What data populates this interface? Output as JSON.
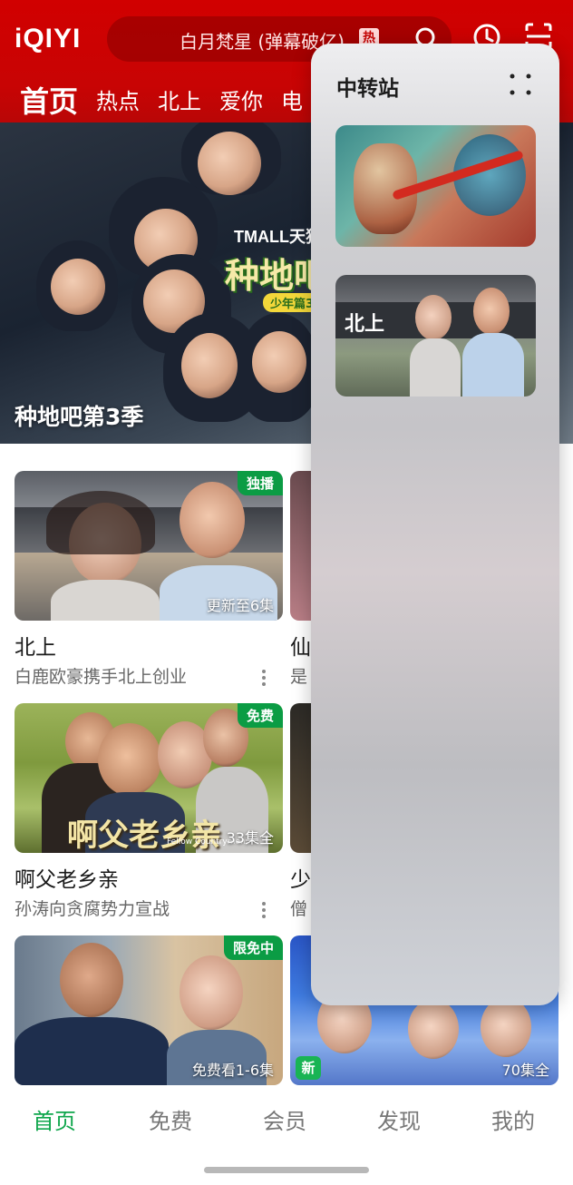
{
  "header": {
    "logo": "iQIYI",
    "search_text": "白月梵星 (弹幕破亿)",
    "hot_badge": "热",
    "tabs": [
      {
        "label": "首页",
        "active": true
      },
      {
        "label": "热点"
      },
      {
        "label": "北上"
      },
      {
        "label": "爱你"
      },
      {
        "label": "电"
      }
    ]
  },
  "hero": {
    "title": "种地吧第3季",
    "tmall": "TMALL天猫",
    "show_logo": "种地吧",
    "show_sub": "少年篇3"
  },
  "cards": [
    {
      "title": "北上",
      "subtitle": "白鹿欧豪携手北上创业",
      "badge": "独播",
      "info": "更新至6集"
    },
    {
      "title": "仙",
      "subtitle": "是"
    },
    {
      "title": "啊父老乡亲",
      "subtitle": "孙涛向贪腐势力宣战",
      "badge": "免费",
      "info": "33集全",
      "overlay_title": "啊父老乡亲",
      "overlay_en": "Fellow Countrymen"
    },
    {
      "title": "少",
      "subtitle": "僧"
    },
    {
      "badge": "限免中",
      "info": "免费看1-6集"
    },
    {
      "new_badge": "新",
      "info": "70集全"
    }
  ],
  "panel": {
    "title": "中转站",
    "item2_text": "北上"
  },
  "bottom_nav": [
    {
      "label": "首页",
      "active": true
    },
    {
      "label": "免费"
    },
    {
      "label": "会员"
    },
    {
      "label": "发现"
    },
    {
      "label": "我的"
    }
  ],
  "colors": {
    "brand_red": "#c80404",
    "accent_green": "#0fa64c"
  }
}
